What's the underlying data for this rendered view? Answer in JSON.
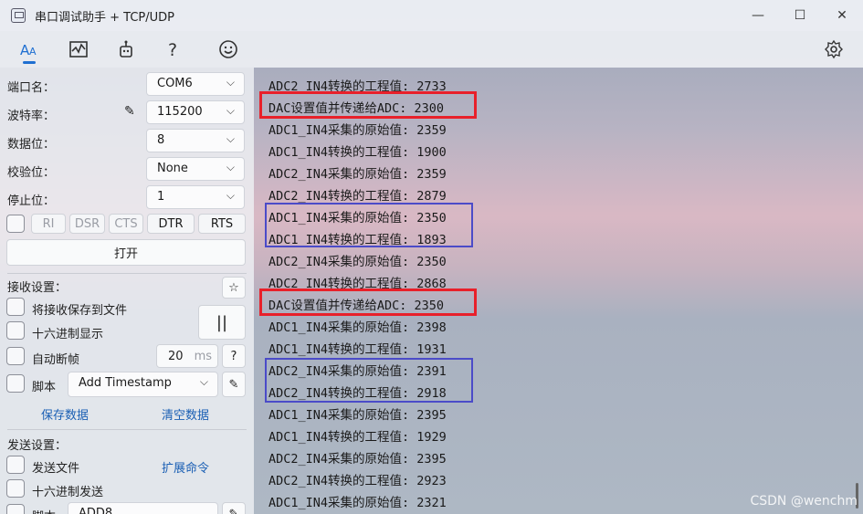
{
  "window": {
    "title": "串口调试助手 + TCP/UDP",
    "minimize": "—",
    "maximize": "☐",
    "close": "✕"
  },
  "toolbar": {
    "tools": [
      "font-icon",
      "chart-icon",
      "plugin-icon",
      "help-icon",
      "smiley-icon",
      "gear-icon"
    ]
  },
  "serial": {
    "port_label": "端口名：",
    "port_value": "COM6",
    "baud_label": "波特率：",
    "baud_value": "115200",
    "data_bits_label": "数据位：",
    "data_bits_value": "8",
    "parity_label": "校验位：",
    "parity_value": "None",
    "stop_bits_label": "停止位：",
    "stop_bits_value": "1",
    "signals": [
      "RI",
      "DSR",
      "CTS",
      "DTR",
      "RTS"
    ],
    "open_button": "打开"
  },
  "receive": {
    "title": "接收设置：",
    "save_to_file": "将接收保存到文件",
    "hex_display": "十六进制显示",
    "auto_frame": "自动断帧",
    "frame_ms_value": "20",
    "frame_ms_unit": "ms",
    "help": "?",
    "script_label": "脚本",
    "script_value": "Add Timestamp",
    "save_data": "保存数据",
    "clear_data": "清空数据",
    "pause": "||",
    "star": "☆"
  },
  "send": {
    "title": "发送设置：",
    "send_file": "发送文件",
    "extend_cmd": "扩展命令",
    "hex_send": "十六进制发送",
    "script_label": "脚本",
    "script_value": "ADD8"
  },
  "log": [
    "ADC2_IN4转换的工程值: 2733",
    "DAC设置值并传递给ADC: 2300",
    "ADC1_IN4采集的原始值: 2359",
    "ADC1_IN4转换的工程值: 1900",
    "ADC2_IN4采集的原始值: 2359",
    "ADC2_IN4转换的工程值: 2879",
    "ADC1_IN4采集的原始值: 2350",
    "ADC1_IN4转换的工程值: 1893",
    "ADC2_IN4采集的原始值: 2350",
    "ADC2_IN4转换的工程值: 2868",
    "DAC设置值并传递给ADC: 2350",
    "ADC1_IN4采集的原始值: 2398",
    "ADC1_IN4转换的工程值: 1931",
    "ADC2_IN4采集的原始值: 2391",
    "ADC2_IN4转换的工程值: 2918",
    "ADC1_IN4采集的原始值: 2395",
    "ADC1_IN4转换的工程值: 1929",
    "ADC2_IN4采集的原始值: 2395",
    "ADC2_IN4转换的工程值: 2923",
    "ADC1_IN4采集的原始值: 2321"
  ],
  "watermark": "CSDN @wenchm"
}
